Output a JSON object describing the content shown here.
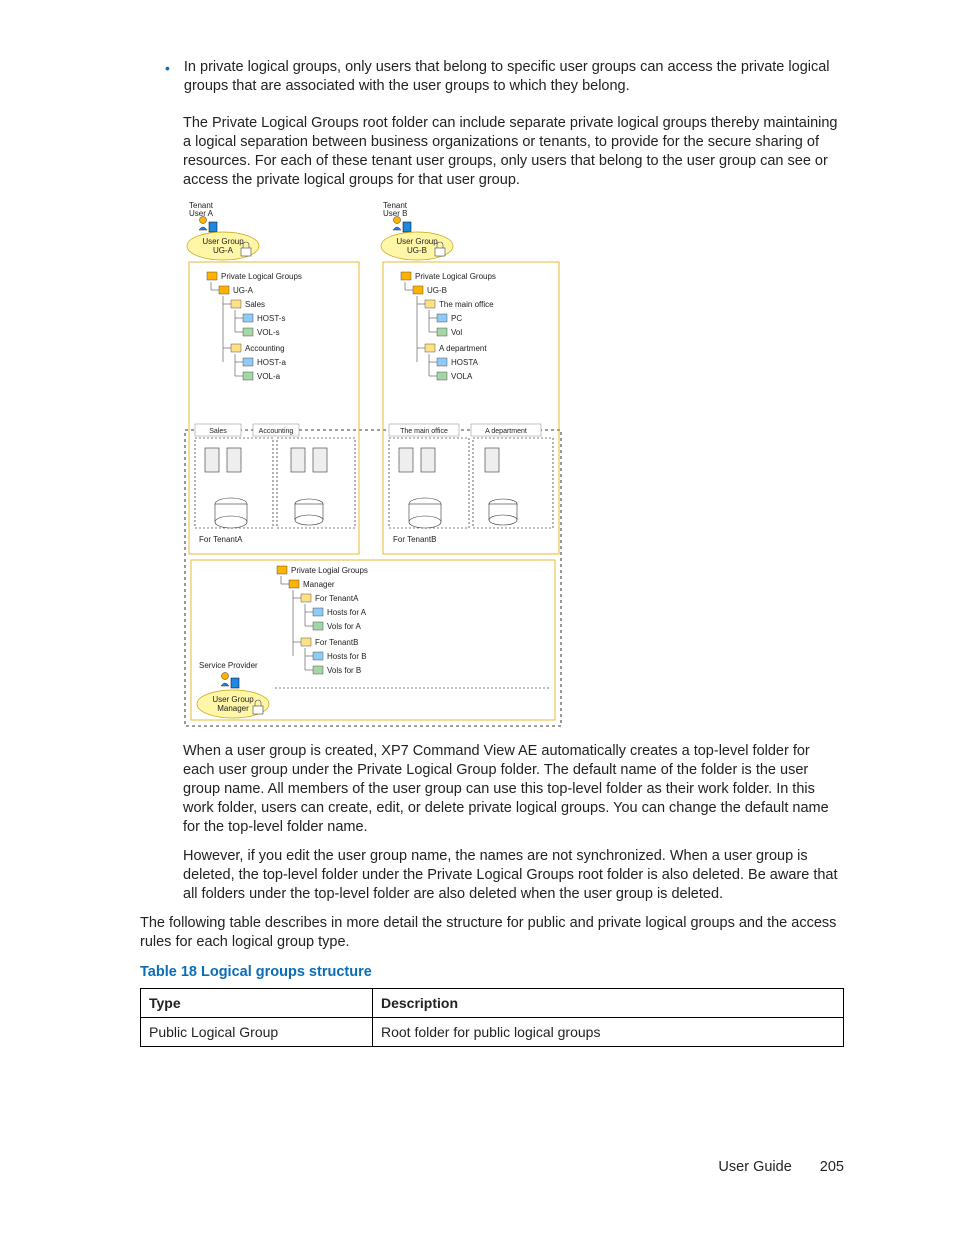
{
  "bullet1": "In private logical groups, only users that belong to specific user groups can access the private logical groups that are associated with the user groups to which they belong.",
  "para1": "The Private Logical Groups root folder can include separate private logical groups thereby maintaining a logical separation between business organizations or tenants, to provide for the secure sharing of resources. For each of these tenant user groups, only users that belong to the user group can see or access the private logical groups for that user group.",
  "para2": "When a user group is created, XP7 Command View AE automatically creates a top-level folder for each user group under the Private Logical Group folder. The default name of the folder is the user group name. All members of the user group can use this top-level folder as their work folder. In this work folder, users can create, edit, or delete private logical groups. You can change the default name for the top-level folder name.",
  "para3": "However, if you edit the user group name, the names are not synchronized. When a user group is deleted, the top-level folder under the Private Logical Groups root folder is also deleted. Be aware that all folders under the top-level folder are also deleted when the user group is deleted.",
  "para4": "The following table describes in more detail the structure for public and private logical groups and the access rules for each logical group type.",
  "table_caption": "Table 18 Logical groups structure",
  "table": {
    "headers": [
      "Type",
      "Description"
    ],
    "rows": [
      [
        "Public Logical Group",
        "Root folder for public logical groups"
      ]
    ]
  },
  "diagram": {
    "tenantA_label": "Tenant",
    "userA_label": "User A",
    "ugA": "User Group",
    "ugA_name": "UG-A",
    "tenantB_label": "Tenant",
    "userB_label": "User B",
    "ugB": "User Group",
    "ugB_name": "UG-B",
    "plg": "Private Logical Groups",
    "treeA": {
      "root": "UG-A",
      "n1": "Sales",
      "n1a": "HOST-s",
      "n1b": "VOL-s",
      "n2": "Accounting",
      "n2a": "HOST-a",
      "n2b": "VOL-a"
    },
    "treeB": {
      "root": "UG-B",
      "n1": "The main office",
      "n1a": "PC",
      "n1b": "Vol",
      "n2": "A department",
      "n2a": "HOSTA",
      "n2b": "VOLA"
    },
    "boxA_l": "Sales",
    "boxA_r": "Accounting",
    "boxB_l": "The main office",
    "boxB_r": "A department",
    "forA": "For TenantA",
    "forB": "For TenantB",
    "sp": "Service Provider",
    "ugM": "User Group",
    "ugM_name": "Manager",
    "sp_plg": "Private Logial Groups",
    "sp_root": "Manager",
    "sp_n1": "For TenantA",
    "sp_n1a": "Hosts for A",
    "sp_n1b": "Vols for A",
    "sp_n2": "For TenantB",
    "sp_n2a": "Hosts for B",
    "sp_n2b": "Vols for B"
  },
  "footer": {
    "guide": "User Guide",
    "page": "205"
  }
}
